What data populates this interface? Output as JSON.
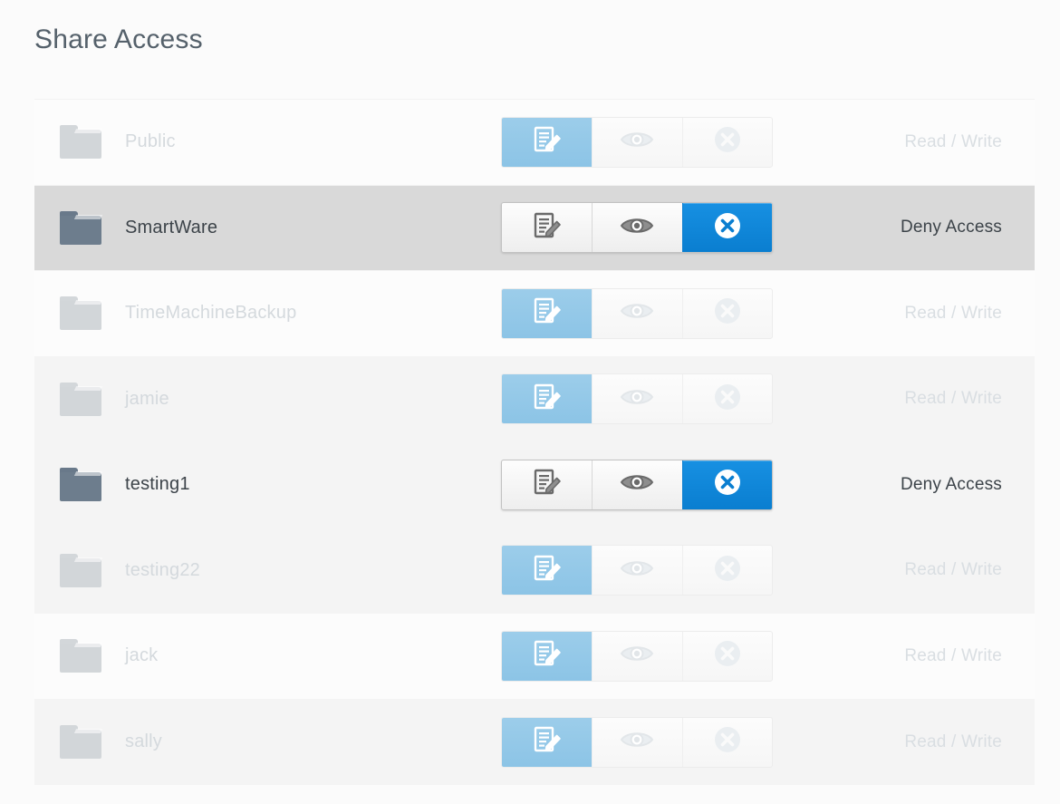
{
  "page": {
    "title": "Share Access",
    "background_color": "#fbfbfb"
  },
  "colors": {
    "accent_selected": "#0a7ed0",
    "accent_selected_muted": "#9ccdea",
    "row_selected_bg": "#d9d9d9",
    "row_alt_bg": "#f4f4f4",
    "row_plain_bg": "#fcfcfc",
    "text_enabled": "#3c4349",
    "text_disabled": "#d4d9dd",
    "folder_enabled": "#6d7d8d",
    "folder_disabled": "#d2d6d9"
  },
  "controls": {
    "read_write_label": "Read / Write",
    "read_only_label": "Read Only",
    "deny_access_label": "Deny Access",
    "icons": {
      "read_write": "document-pencil-icon",
      "read_only": "eye-icon",
      "deny_access": "x-circle-icon",
      "folder": "folder-icon"
    }
  },
  "rows": [
    {
      "name": "Public",
      "enabled": false,
      "row_style": "plain",
      "selected_permission": "read_write",
      "status": "Read / Write"
    },
    {
      "name": "SmartWare",
      "enabled": true,
      "row_style": "selected",
      "selected_permission": "deny_access",
      "status": "Deny Access"
    },
    {
      "name": "TimeMachineBackup",
      "enabled": false,
      "row_style": "plain",
      "selected_permission": "read_write",
      "status": "Read / Write"
    },
    {
      "name": "jamie",
      "enabled": false,
      "row_style": "alt",
      "selected_permission": "read_write",
      "status": "Read / Write"
    },
    {
      "name": "testing1",
      "enabled": true,
      "row_style": "alt",
      "selected_permission": "deny_access",
      "status": "Deny Access"
    },
    {
      "name": "testing22",
      "enabled": false,
      "row_style": "alt",
      "selected_permission": "read_write",
      "status": "Read / Write"
    },
    {
      "name": "jack",
      "enabled": false,
      "row_style": "plain",
      "selected_permission": "read_write",
      "status": "Read / Write"
    },
    {
      "name": "sally",
      "enabled": false,
      "row_style": "alt",
      "selected_permission": "read_write",
      "status": "Read / Write"
    }
  ]
}
